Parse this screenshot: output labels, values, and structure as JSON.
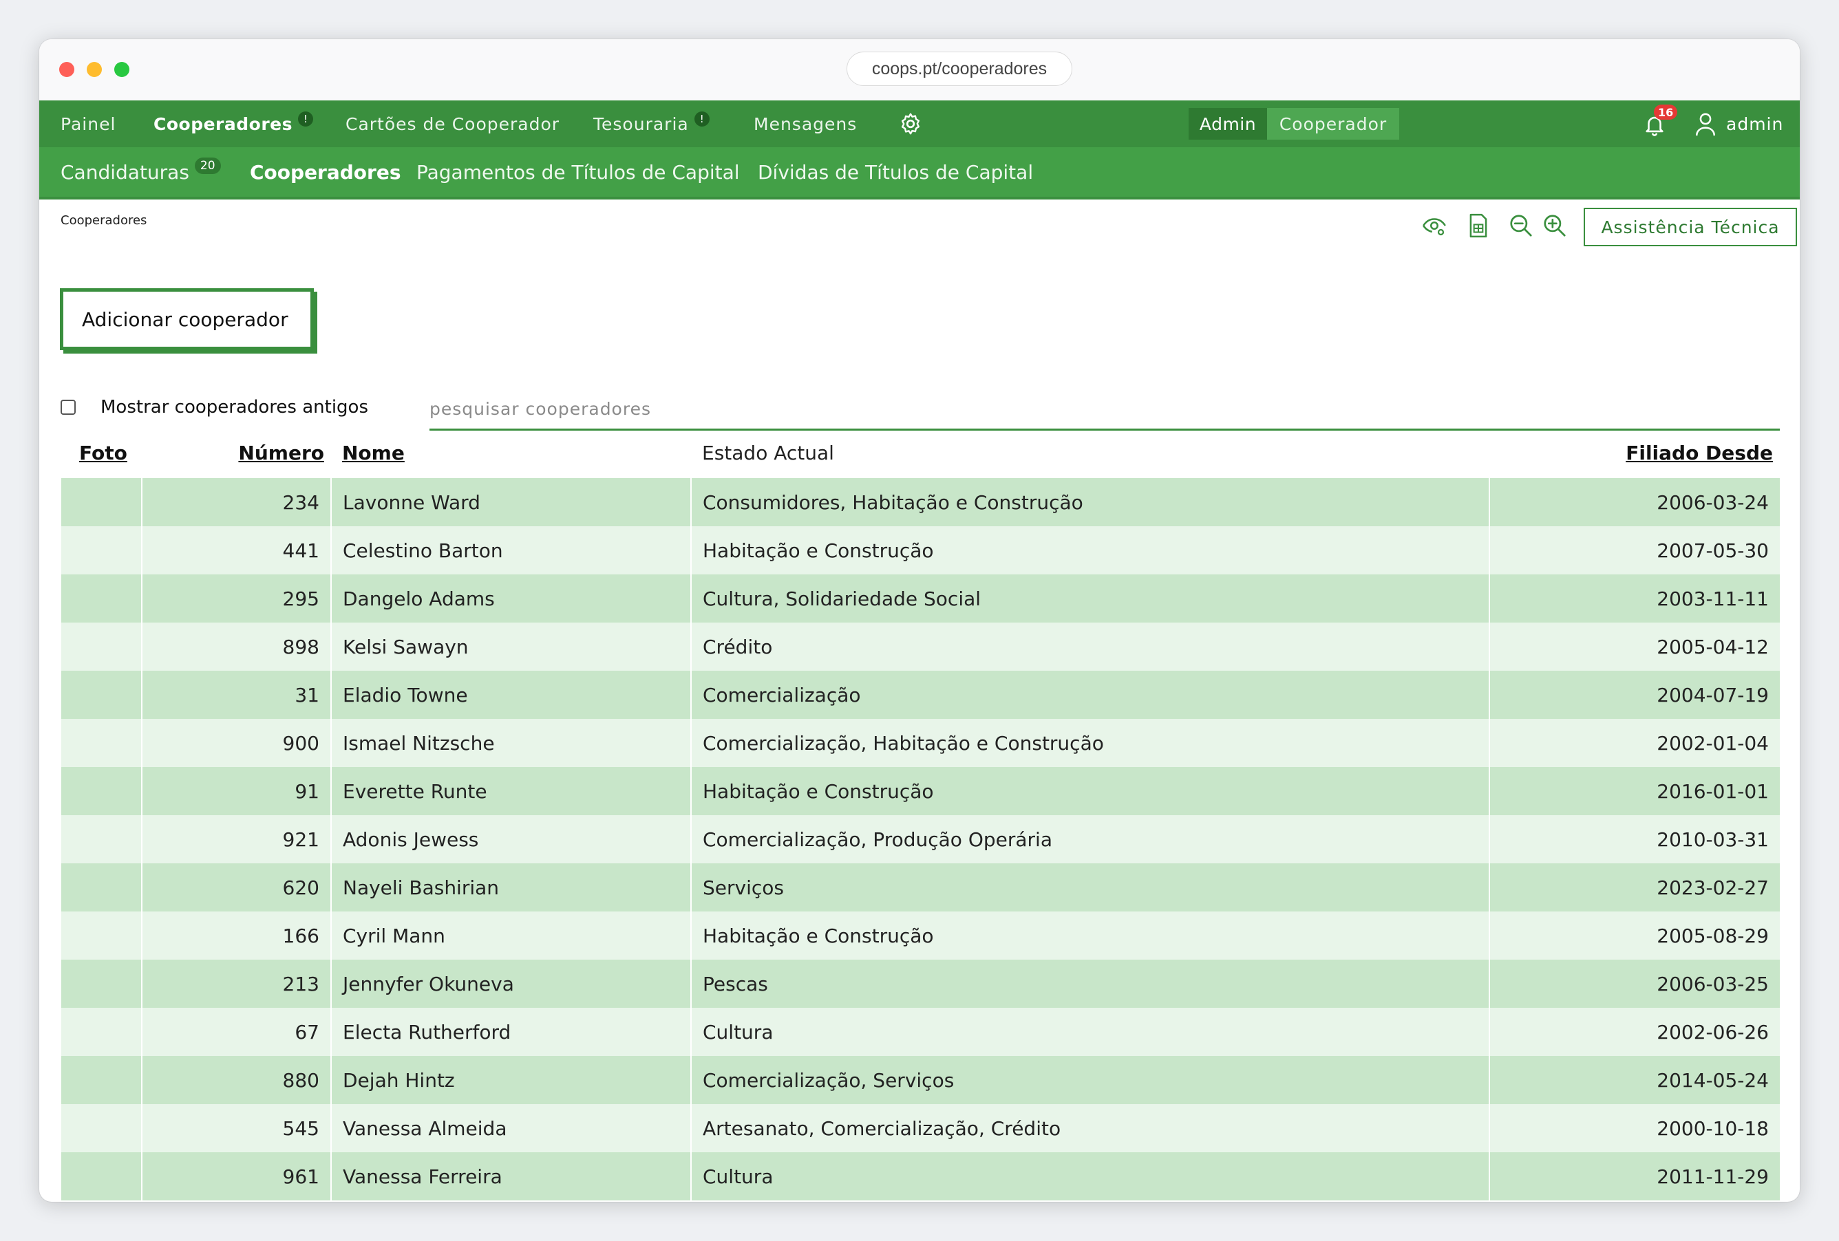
{
  "browser": {
    "url": "coops.pt/cooperadores"
  },
  "topnav": {
    "items": [
      {
        "label": "Painel"
      },
      {
        "label": "Cooperadores",
        "badge": "!"
      },
      {
        "label": "Cartões de Cooperador"
      },
      {
        "label": "Tesouraria",
        "badge": "!"
      },
      {
        "label": "Mensagens"
      }
    ],
    "mode_admin": "Admin",
    "mode_cooperador": "Cooperador",
    "notifications_count": "16",
    "user": "admin"
  },
  "subnav": {
    "items": [
      {
        "label": "Candidaturas",
        "badge": "20"
      },
      {
        "label": "Cooperadores"
      },
      {
        "label": "Pagamentos de Títulos de Capital"
      },
      {
        "label": "Dívidas de Títulos de Capital"
      }
    ]
  },
  "breadcrumb": "Cooperadores",
  "toolbar": {
    "icons": [
      "visibility-settings-icon",
      "spreadsheet-export-icon",
      "zoom-out-icon",
      "zoom-in-icon"
    ],
    "assist_label": "Assistência Técnica"
  },
  "add_button_label": "Adicionar cooperador",
  "filter": {
    "show_old_label": "Mostrar cooperadores antigos",
    "show_old_checked": false,
    "search_placeholder": "pesquisar cooperadores",
    "search_value": ""
  },
  "table": {
    "headers": {
      "foto": "Foto",
      "numero": "Número",
      "nome": "Nome",
      "estado": "Estado Actual",
      "filiado": "Filiado Desde"
    },
    "rows": [
      {
        "numero": "234",
        "nome": "Lavonne Ward",
        "estado": "Consumidores, Habitação e Construção",
        "filiado": "2006-03-24"
      },
      {
        "numero": "441",
        "nome": "Celestino Barton",
        "estado": "Habitação e Construção",
        "filiado": "2007-05-30"
      },
      {
        "numero": "295",
        "nome": "Dangelo Adams",
        "estado": "Cultura, Solidariedade Social",
        "filiado": "2003-11-11"
      },
      {
        "numero": "898",
        "nome": "Kelsi Sawayn",
        "estado": "Crédito",
        "filiado": "2005-04-12"
      },
      {
        "numero": "31",
        "nome": "Eladio Towne",
        "estado": "Comercialização",
        "filiado": "2004-07-19"
      },
      {
        "numero": "900",
        "nome": "Ismael Nitzsche",
        "estado": "Comercialização, Habitação e Construção",
        "filiado": "2002-01-04"
      },
      {
        "numero": "91",
        "nome": "Everette Runte",
        "estado": "Habitação e Construção",
        "filiado": "2016-01-01"
      },
      {
        "numero": "921",
        "nome": "Adonis Jewess",
        "estado": "Comercialização, Produção Operária",
        "filiado": "2010-03-31"
      },
      {
        "numero": "620",
        "nome": "Nayeli Bashirian",
        "estado": "Serviços",
        "filiado": "2023-02-27"
      },
      {
        "numero": "166",
        "nome": "Cyril Mann",
        "estado": "Habitação e Construção",
        "filiado": "2005-08-29"
      },
      {
        "numero": "213",
        "nome": "Jennyfer Okuneva",
        "estado": "Pescas",
        "filiado": "2006-03-25"
      },
      {
        "numero": "67",
        "nome": "Electa Rutherford",
        "estado": "Cultura",
        "filiado": "2002-06-26"
      },
      {
        "numero": "880",
        "nome": "Dejah Hintz",
        "estado": "Comercialização, Serviços",
        "filiado": "2014-05-24"
      },
      {
        "numero": "545",
        "nome": "Vanessa Almeida",
        "estado": "Artesanato, Comercialização, Crédito",
        "filiado": "2000-10-18"
      },
      {
        "numero": "961",
        "nome": "Vanessa Ferreira",
        "estado": "Cultura",
        "filiado": "2011-11-29"
      }
    ]
  },
  "colors": {
    "nav_dark": "#3a8f3e",
    "nav_light": "#43a047",
    "row_odd": "#c8e6c9",
    "row_even": "#e8f5e9",
    "badge_red": "#e53935"
  }
}
